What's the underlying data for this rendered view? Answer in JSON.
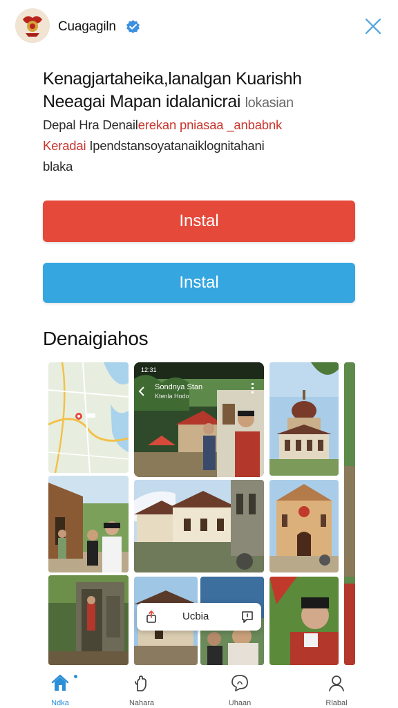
{
  "header": {
    "app_name": "Cuagagiln",
    "icons": {
      "logo": "emblem-logo",
      "verified": "verified-badge-icon",
      "close": "close-icon"
    },
    "colors": {
      "verified": "#3a8fe0",
      "close": "#5aa9dc"
    }
  },
  "content": {
    "headline_line1": "Kenagjartaheika,lanalgan Kuarishh",
    "headline_line2": "Neeagai Mapan idalanicrai",
    "headline_line2_faded": "lokasian",
    "desc_line1_a": "Depal Hra Denail",
    "desc_line1_b": "erekan pniasaa _anbabnk",
    "desc_line2_a": "Keradai",
    "desc_line2_b": " Ipendstansoyatanaiklognitahani",
    "desc_line3": "blaka"
  },
  "buttons": {
    "primary_label": "Instal",
    "secondary_label": "Instal",
    "primary_color": "#e5493a",
    "secondary_color": "#35a6df"
  },
  "gallery": {
    "title": "Denaigiahos",
    "phone_screen_title": "Sondnya Stan",
    "phone_screen_subtitle": "Ktenla Hodo",
    "phone_status_time": "12:31",
    "toast_label": "Ucbia"
  },
  "bottom_nav": {
    "items": [
      {
        "label": "Ndka",
        "icon": "home-icon",
        "active": true
      },
      {
        "label": "Nahara",
        "icon": "hand-icon",
        "active": false
      },
      {
        "label": "Uhaan",
        "icon": "chat-icon",
        "active": false
      },
      {
        "label": "Rlabal",
        "icon": "profile-icon",
        "active": false
      }
    ],
    "active_color": "#2b8fd6"
  }
}
